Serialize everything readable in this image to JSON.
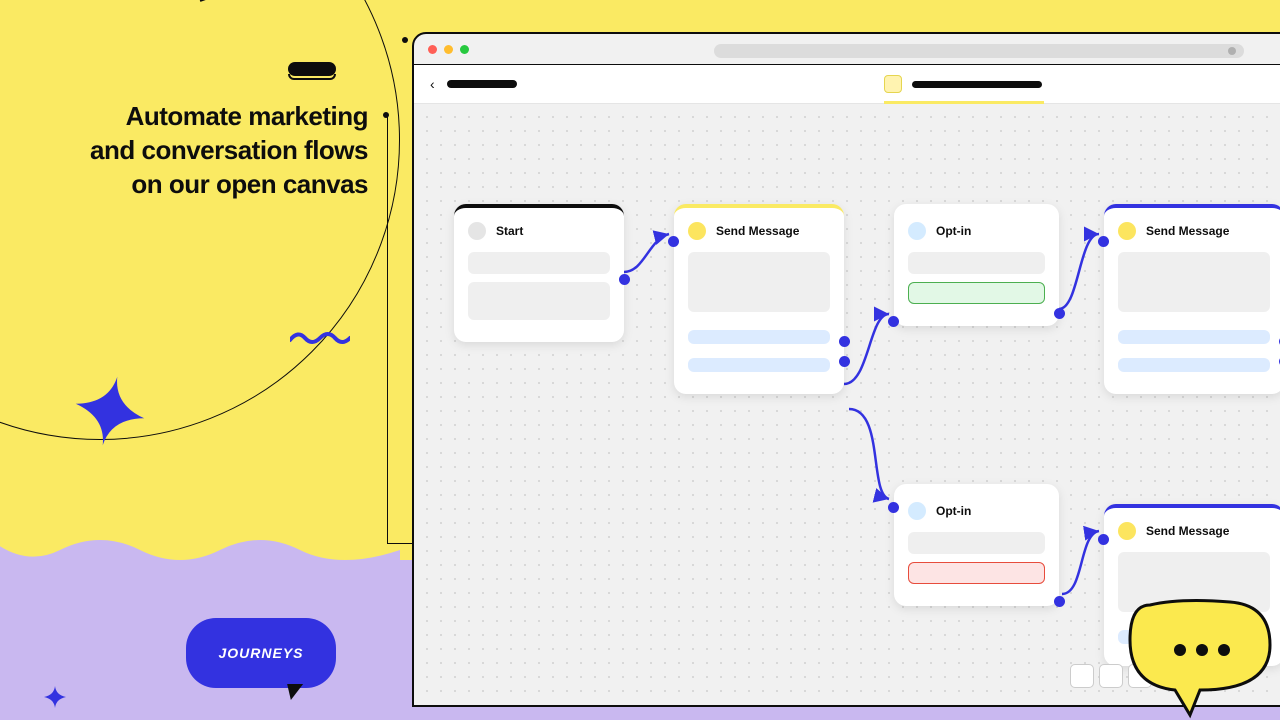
{
  "hero": {
    "headline": "Automate marketing and conversation flows on our open canvas"
  },
  "badge": {
    "label": "JOURNEYS"
  },
  "nodes": {
    "start": {
      "title": "Start"
    },
    "send1": {
      "title": "Send Message"
    },
    "optin1": {
      "title": "Opt-in"
    },
    "send2": {
      "title": "Send Message"
    },
    "optin2": {
      "title": "Opt-in"
    },
    "send3": {
      "title": "Send Message"
    }
  }
}
